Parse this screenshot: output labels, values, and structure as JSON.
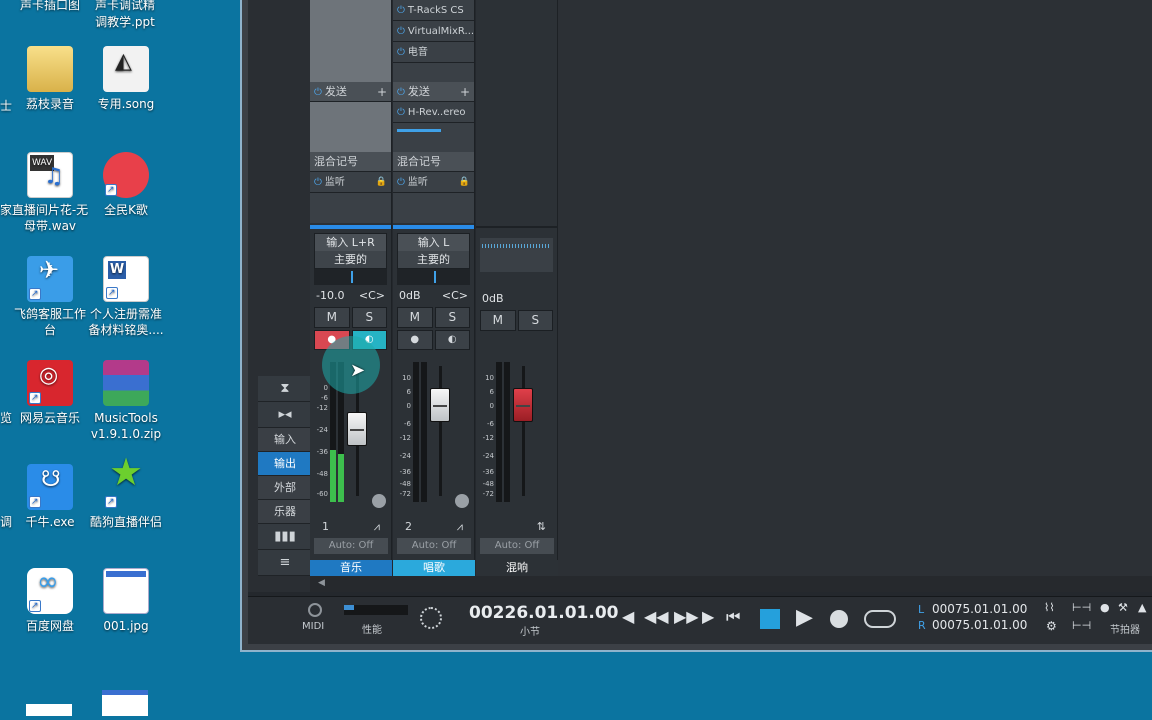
{
  "desktop": {
    "icons": [
      {
        "label": "荔枝录音",
        "kind": "folder"
      },
      {
        "label": "专用.song",
        "kind": "song"
      },
      {
        "label": "直播间片花-无母带.wav",
        "kind": "wav"
      },
      {
        "label": "全民K歌",
        "kind": "app"
      },
      {
        "label": "飞鸽客服工作台",
        "kind": "app"
      },
      {
        "label": "个人注册需准备材料铭奥....",
        "kind": "doc"
      },
      {
        "label": "网易云音乐",
        "kind": "app"
      },
      {
        "label": "MusicTools v1.9.1.0.zip",
        "kind": "zip"
      },
      {
        "label": "千牛.exe",
        "kind": "app"
      },
      {
        "label": "酷狗直播伴侣",
        "kind": "app"
      },
      {
        "label": "百度网盘",
        "kind": "app"
      },
      {
        "label": "001.jpg",
        "kind": "image"
      }
    ],
    "top_partial": [
      "声卡插口图",
      "声卡调试精调教学.ppt"
    ],
    "left_partial": [
      "士",
      "家",
      "览",
      "调"
    ]
  },
  "mixer": {
    "side_nav": [
      "输入",
      "输出",
      "外部",
      "乐器"
    ],
    "side_nav_active": "输出",
    "channels": [
      {
        "inserts": [],
        "sends_label": "发送",
        "sends": [],
        "mix_label": "混合记号",
        "monitor_label": "监听",
        "route_in": "输入 L+R",
        "route_out": "主要的",
        "volume": "-10.0",
        "pan": "<C>",
        "mute": "M",
        "solo": "S",
        "number": "1",
        "auto": "Auto: Off",
        "name": "音乐",
        "name_color": "#1f79c2"
      },
      {
        "inserts": [
          "T-RackS CS",
          "VirtualMixR...",
          "电音"
        ],
        "sends_label": "发送",
        "sends": [
          "H-Rev..ereo"
        ],
        "mix_label": "混合记号",
        "monitor_label": "监听",
        "route_in": "输入 L",
        "route_out": "主要的",
        "volume": "0dB",
        "pan": "<C>",
        "mute": "M",
        "solo": "S",
        "number": "2",
        "auto": "Auto: Off",
        "name": "唱歌",
        "name_color": "#2ba9dc"
      },
      {
        "volume": "0dB",
        "mute": "M",
        "solo": "S",
        "auto": "Auto: Off",
        "name": "混响",
        "name_color": "#2c3136"
      }
    ],
    "scale_labels": [
      "10",
      "6",
      "0",
      "-6",
      "-12",
      "-24",
      "-36",
      "-48",
      "-72"
    ],
    "scale_labels_ch1": [
      "0",
      "-6",
      "-12",
      "-24",
      "-36",
      "-48",
      "-60"
    ]
  },
  "transport": {
    "midi": "MIDI",
    "perf": "性能",
    "position": "00226.01.01.00",
    "position_unit": "小节",
    "loop_l_label": "L",
    "loop_l": "00075.01.01.00",
    "loop_r_label": "R",
    "loop_r": "00075.01.01.00",
    "metronome": "节拍器"
  }
}
